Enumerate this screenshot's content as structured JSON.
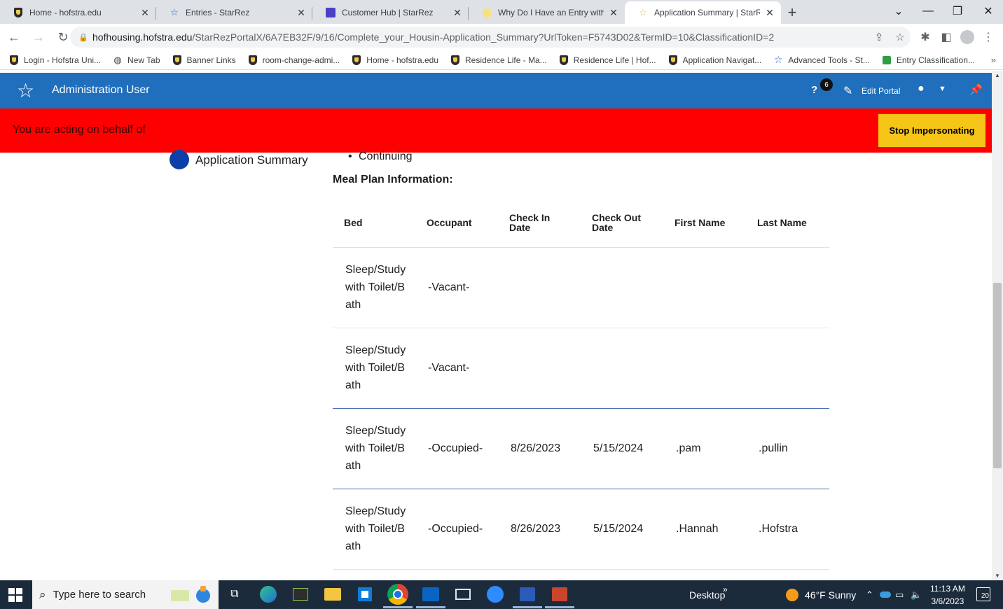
{
  "browser": {
    "tabs": [
      {
        "title": "Home - hofstra.edu",
        "icon": "hofstra-shield-icon"
      },
      {
        "title": "Entries - StarRez",
        "icon": "starrez-star-icon"
      },
      {
        "title": "Customer Hub | StarRez",
        "icon": "customer-hub-icon"
      },
      {
        "title": "Why Do I Have an Entry with a Re",
        "icon": "lightbulb-icon"
      },
      {
        "title": "Application Summary | StarRez P",
        "icon": "starrez-star-icon",
        "active": true
      }
    ],
    "url_host": "hofhousing.hofstra.edu",
    "url_path": "/StarRezPortalX/6A7EB32F/9/16/Complete_your_Housin-Application_Summary?UrlToken=F5743D02&TermID=10&ClassificationID=2",
    "bookmarks": [
      {
        "label": "Login - Hofstra Uni...",
        "icon": "hofstra-shield-icon"
      },
      {
        "label": "New Tab",
        "icon": "globe-icon"
      },
      {
        "label": "Banner Links",
        "icon": "hofstra-shield-icon"
      },
      {
        "label": "room-change-admi...",
        "icon": "hofstra-shield-icon"
      },
      {
        "label": "Home - hofstra.edu",
        "icon": "hofstra-shield-icon"
      },
      {
        "label": "Residence Life - Ma...",
        "icon": "hofstra-shield-icon"
      },
      {
        "label": "Residence Life | Hof...",
        "icon": "hofstra-shield-icon"
      },
      {
        "label": "Application Navigat...",
        "icon": "hofstra-shield-icon"
      },
      {
        "label": "Advanced Tools - St...",
        "icon": "starrez-star-icon"
      },
      {
        "label": "Entry Classification...",
        "icon": "classification-icon"
      }
    ],
    "bookmarks_more": "»"
  },
  "portal": {
    "user_name": "Administration User",
    "help_icon": "?",
    "notification_count": "6",
    "edit_portal_label": "Edit Portal",
    "impersonation_message": "You are acting on behalf of",
    "stop_impersonating_label": "Stop Impersonating",
    "step_label": "Application Summary",
    "continuing_bullet": "Continuing",
    "meal_plan_heading": "Meal Plan Information:"
  },
  "table": {
    "headers": [
      "Bed",
      "Occupant",
      "Check In Date",
      "Check Out Date",
      "First Name",
      "Last Name"
    ],
    "header_lines": {
      "check_in": [
        "Check In",
        "Date"
      ],
      "check_out": [
        "Check Out",
        "Date"
      ]
    },
    "rows": [
      {
        "bed": "Sleep/Study with Toilet/Bath",
        "occupant": "-Vacant-",
        "check_in": "",
        "check_out": "",
        "first_name": "",
        "last_name": ""
      },
      {
        "bed": "Sleep/Study with Toilet/Bath",
        "occupant": "-Vacant-",
        "check_in": "",
        "check_out": "",
        "first_name": "",
        "last_name": ""
      },
      {
        "bed": "Sleep/Study with Toilet/Bath",
        "occupant": "-Occupied-",
        "check_in": "8/26/2023",
        "check_out": "5/15/2024",
        "first_name": ".pam",
        "last_name": ".pullin"
      },
      {
        "bed": "Sleep/Study with Toilet/Bath",
        "occupant": "-Occupied-",
        "check_in": "8/26/2023",
        "check_out": "5/15/2024",
        "first_name": ".Hannah",
        "last_name": ".Hofstra"
      }
    ]
  },
  "taskbar": {
    "search_placeholder": "Type here to search",
    "desktop_label": "Desktop",
    "weather": "46°F  Sunny",
    "time": "11:13 AM",
    "date": "3/6/2023",
    "notification_count": "20"
  },
  "colors": {
    "portal_blue": "#1f6fbd",
    "impersonation_red": "#ff0000",
    "stop_button_yellow": "#f5c518",
    "step_dot_blue": "#0d3fa8"
  }
}
